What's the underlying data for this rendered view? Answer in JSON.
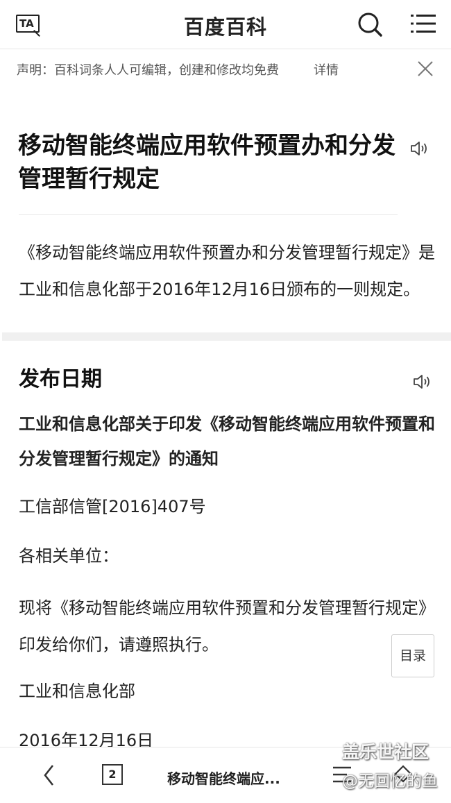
{
  "header": {
    "logo_text": "TA",
    "brand": "百度百科",
    "icons": [
      "ta-logo-icon",
      "search-icon",
      "menu-icon"
    ]
  },
  "notice_bar": {
    "text": "声明：百科词条人人可编辑，创建和修改均免费",
    "detail_link": "详情"
  },
  "article": {
    "title": "移动智能终端应用软件预置办和分发管理暂行规定",
    "summary": "《移动智能终端应用软件预置办和分发管理暂行规定》是工业和信息化部于2016年12月16日颁布的一则规定。",
    "section_title": "发布日期",
    "notice_heading": "工业和信息化部关于印发《移动智能终端应用软件预置和分发管理暂行规定》的通知",
    "doc_number": "工信部信管[2016]407号",
    "salutation": "各相关单位：",
    "body": "现将《移动智能终端应用软件预置和分发管理暂行规定》印发给你们，请遵照执行。",
    "issuer": "工业和信息化部",
    "date": "2016年12月16日"
  },
  "toc_button": "目录",
  "bottom_bar": {
    "tab_count": "2",
    "page_title": "移动智能终端应..."
  },
  "watermark": {
    "brand": "盖乐世社区",
    "user": "@无回忆的鱼"
  }
}
